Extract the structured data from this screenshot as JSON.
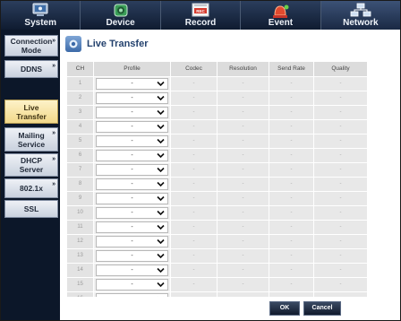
{
  "topnav": {
    "tabs": [
      {
        "label": "System",
        "icon": "monitor-icon"
      },
      {
        "label": "Device",
        "icon": "camera-icon"
      },
      {
        "label": "Record",
        "icon": "record-icon"
      },
      {
        "label": "Event",
        "icon": "alarm-icon"
      },
      {
        "label": "Network",
        "icon": "network-icon"
      }
    ],
    "active": "Network"
  },
  "sidebar": {
    "items": [
      {
        "label": "Connection Mode",
        "line1": "Connection",
        "line2": "Mode",
        "expandable": true
      },
      {
        "label": "DDNS",
        "line1": "DDNS",
        "line2": "",
        "expandable": true
      },
      {
        "label": "Live Transfer",
        "line1": "Live",
        "line2": "Transfer",
        "expandable": false,
        "active": true
      },
      {
        "label": "Mailing Service",
        "line1": "Mailing",
        "line2": "Service",
        "expandable": true
      },
      {
        "label": "DHCP Server",
        "line1": "DHCP",
        "line2": "Server",
        "expandable": true
      },
      {
        "label": "802.1x",
        "line1": "802.1x",
        "line2": "",
        "expandable": true
      },
      {
        "label": "SSL",
        "line1": "SSL",
        "line2": "",
        "expandable": false
      }
    ]
  },
  "main": {
    "title": "Live Transfer",
    "columns": [
      "CH",
      "Profile",
      "Codec",
      "Resolution",
      "Send Rate",
      "Quality"
    ],
    "rows": [
      {
        "ch": "1",
        "profile": "-",
        "codec": "-",
        "resolution": "-",
        "send_rate": "-",
        "quality": "-"
      },
      {
        "ch": "2",
        "profile": "-",
        "codec": "-",
        "resolution": "-",
        "send_rate": "-",
        "quality": "-"
      },
      {
        "ch": "3",
        "profile": "-",
        "codec": "-",
        "resolution": "-",
        "send_rate": "-",
        "quality": "-"
      },
      {
        "ch": "4",
        "profile": "-",
        "codec": "-",
        "resolution": "-",
        "send_rate": "-",
        "quality": "-"
      },
      {
        "ch": "5",
        "profile": "-",
        "codec": "-",
        "resolution": "-",
        "send_rate": "-",
        "quality": "-"
      },
      {
        "ch": "6",
        "profile": "-",
        "codec": "-",
        "resolution": "-",
        "send_rate": "-",
        "quality": "-"
      },
      {
        "ch": "7",
        "profile": "-",
        "codec": "-",
        "resolution": "-",
        "send_rate": "-",
        "quality": "-"
      },
      {
        "ch": "8",
        "profile": "-",
        "codec": "-",
        "resolution": "-",
        "send_rate": "-",
        "quality": "-"
      },
      {
        "ch": "9",
        "profile": "-",
        "codec": "-",
        "resolution": "-",
        "send_rate": "-",
        "quality": "-"
      },
      {
        "ch": "10",
        "profile": "-",
        "codec": "-",
        "resolution": "-",
        "send_rate": "-",
        "quality": "-"
      },
      {
        "ch": "11",
        "profile": "-",
        "codec": "-",
        "resolution": "-",
        "send_rate": "-",
        "quality": "-"
      },
      {
        "ch": "12",
        "profile": "-",
        "codec": "-",
        "resolution": "-",
        "send_rate": "-",
        "quality": "-"
      },
      {
        "ch": "13",
        "profile": "-",
        "codec": "-",
        "resolution": "-",
        "send_rate": "-",
        "quality": "-"
      },
      {
        "ch": "14",
        "profile": "-",
        "codec": "-",
        "resolution": "-",
        "send_rate": "-",
        "quality": "-"
      },
      {
        "ch": "15",
        "profile": "-",
        "codec": "-",
        "resolution": "-",
        "send_rate": "-",
        "quality": "-"
      },
      {
        "ch": "16",
        "profile": "-",
        "codec": "-",
        "resolution": "-",
        "send_rate": "-",
        "quality": "-"
      }
    ],
    "ok_label": "OK",
    "cancel_label": "Cancel"
  },
  "colors": {
    "nav_bg": "#0d1626",
    "sidebar_bg": "#0c1729",
    "active_item": "#f2d98a",
    "title_text": "#24426e",
    "table_header": "#dcdcdc",
    "table_cell": "#e8e8e8"
  }
}
